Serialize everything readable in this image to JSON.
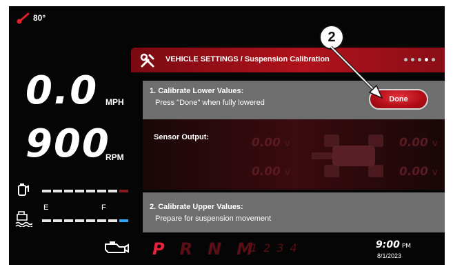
{
  "temperature": "80°",
  "speed": {
    "value": "0.0",
    "unit": "MPH"
  },
  "rpm": {
    "value": "900",
    "unit": "RPM"
  },
  "fuel": {
    "empty_label": "E",
    "full_label": "F"
  },
  "header": {
    "breadcrumb": "VEHICLE SETTINGS / Suspension Calibration"
  },
  "step1": {
    "title": "1. Calibrate Lower Values:",
    "instruction": "Press \"Done\" when fully lowered",
    "button": "Done"
  },
  "sensor": {
    "label": "Sensor Output:",
    "front_left": "0.00",
    "front_right": "0.00",
    "rear_left": "0.00",
    "rear_right": "0.00",
    "unit": "V"
  },
  "step2": {
    "title": "2. Calibrate Upper Values:",
    "instruction": "Prepare for suspension movement"
  },
  "gears": [
    "P",
    "R",
    "N",
    "M"
  ],
  "gear_numbers": "1234",
  "active_gear": "P",
  "clock": {
    "time": "9:00",
    "ampm": "PM",
    "date": "8/1/2023"
  },
  "callout": "2",
  "colors": {
    "accent": "#b0121c",
    "active_gear": "#e8203a",
    "panel_gray": "#6e6e6e",
    "fuel_marker": "#2aa8ff",
    "def_marker": "#8a1a20"
  }
}
